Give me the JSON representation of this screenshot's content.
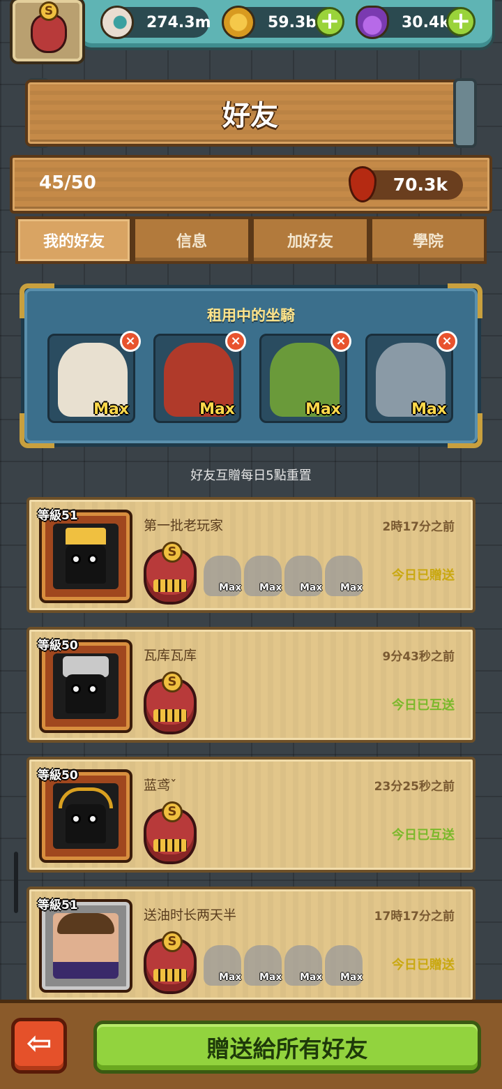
{
  "resources": {
    "eye_value": "274.3m",
    "coin_value": "59.3b",
    "potion_value": "30.4k",
    "plus_label": "+"
  },
  "player_badge_letter": "S",
  "title": "好友",
  "friend_count": "45/50",
  "blood_value": "70.3k",
  "tabs": [
    "我的好友",
    "信息",
    "加好友",
    "學院"
  ],
  "active_tab": "我的好友",
  "rented_mounts": {
    "title": "租用中的坐騎",
    "items": [
      {
        "label": "Max",
        "remove": "×",
        "color": "#e8e0d0"
      },
      {
        "label": "Max",
        "remove": "×",
        "color": "#b03a2a"
      },
      {
        "label": "Max",
        "remove": "×",
        "color": "#6a9a3a"
      },
      {
        "label": "Max",
        "remove": "×",
        "color": "#8a9aa6"
      }
    ]
  },
  "reset_note": "好友互贈每日5點重置",
  "friends": [
    {
      "level": "等級51",
      "name": "第一批老玩家",
      "time": "2時17分之前",
      "status": "今日已贈送",
      "status_color": "#c9a810",
      "mounts": [
        "Max",
        "Max",
        "Max",
        "Max"
      ]
    },
    {
      "level": "等級50",
      "name": "瓦库瓦库",
      "time": "9分43秒之前",
      "status": "今日已互送",
      "status_color": "#7ab82a",
      "mounts": []
    },
    {
      "level": "等級50",
      "name": "蓝鸢ˇ",
      "time": "23分25秒之前",
      "status": "今日已互送",
      "status_color": "#7ab82a",
      "mounts": []
    },
    {
      "level": "等級51",
      "name": "送油时长两天半",
      "time": "17時17分之前",
      "status": "今日已贈送",
      "status_color": "#c9a810",
      "mounts": [
        "Max",
        "Max",
        "Max",
        "Max"
      ]
    }
  ],
  "back_icon": "left-arrow-icon",
  "back_label": "⇦",
  "send_all_label": "贈送給所有好友"
}
